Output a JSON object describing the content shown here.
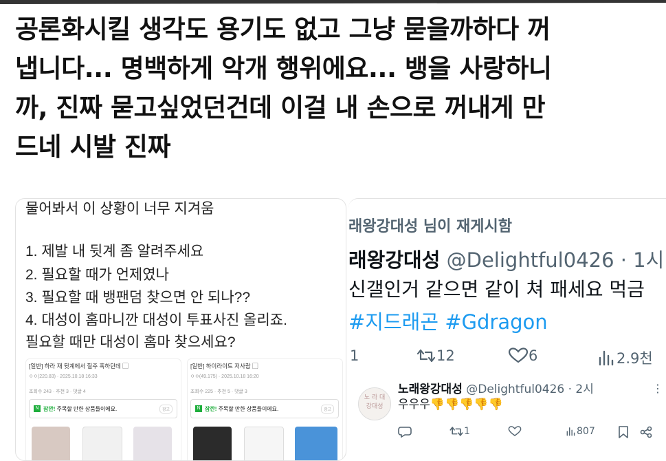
{
  "headline": {
    "lines": [
      "공론화시킬 생각도 용기도 없고 그냥 묻을까하다 꺼",
      "냅니다... 명백하게 악개 행위에요... 뱅을 사랑하니",
      "까,  진짜 묻고싶었던건데 이걸 내 손으로 꺼내게 만",
      "드네 시발 진짜"
    ]
  },
  "left_panel": {
    "line0": "물어봐서 이 상황이 너무 지겨움",
    "items": [
      "1. 제발 내 뒷계 좀 알려주세요",
      "2. 필요할 때가 언제였나",
      "3. 필요할 때 뱅팬덤 찾으면 안 되나??",
      "4. 대성이 홈마니깐 대성이 투표사진 올리죠.",
      "필요할 때만 대성이 홈마 찾으세요?"
    ],
    "cards": [
      {
        "title": "[일반] 하라 재 뒷계에서 질주 혹하던데 ▢",
        "meta": "ㅇㅇ(220.83) · 2025.10.18 16:33",
        "stats": "조회수 243 · 추천 3 · 댓글 4",
        "stats_comment": "",
        "ad_text_green": "잠깐!",
        "ad_text": " 주목할 만한 상품들이에요.",
        "ad_tag": "광고"
      },
      {
        "title": "[일반] 하이라이트 저사람 ▢",
        "meta": "ㅇㅇ(49.175) · 2025.10.18 16:20",
        "stats": "조회수 225 · 추천 5 · 댓글 3",
        "stats_comment": "",
        "ad_text_green": "잠깐!",
        "ad_text": " 주목할 만한 상품들이에요.",
        "ad_tag": "광고"
      }
    ]
  },
  "tweet": {
    "retweeted_by": "래왕강대성 님이 재게시함",
    "author_name": "래왕강대성",
    "author_handle": "@Delightful0426 · 1시",
    "body": "신갤인거 같으면 같이 쳐 패세요 먹금",
    "hashtags": "#지드래곤 #Gdragon",
    "reply_count": "1",
    "retweet_count": "12",
    "like_count": "6",
    "view_count": "2.9천"
  },
  "reply": {
    "avatar_text": [
      "노 라 대",
      "강대성"
    ],
    "author_name": "노래왕강대성",
    "author_handle": "@Delightful0426 · 2시",
    "body": "우우우👎👎👎👎👎",
    "retweet_count": "1",
    "view_count": "807"
  }
}
